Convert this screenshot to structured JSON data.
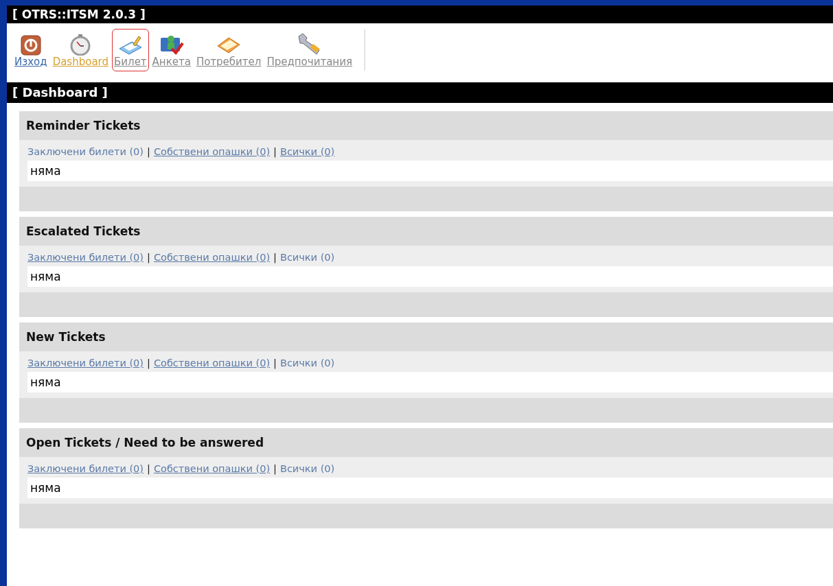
{
  "header": {
    "title": "[ OTRS::ITSM 2.0.3 ]"
  },
  "nav": [
    {
      "label": "Изход",
      "kind": "logout",
      "selected": false,
      "focused": false
    },
    {
      "label": "Dashboard",
      "kind": "dashboard",
      "selected": true,
      "focused": false
    },
    {
      "label": "Билет",
      "kind": "ticket",
      "selected": false,
      "focused": true
    },
    {
      "label": "Анкета",
      "kind": "survey",
      "selected": false,
      "focused": false
    },
    {
      "label": "Потребител",
      "kind": "customer",
      "selected": false,
      "focused": false
    },
    {
      "label": "Предпочитания",
      "kind": "preferences",
      "selected": false,
      "focused": false
    }
  ],
  "page_title": "[ Dashboard ]",
  "panels": [
    {
      "title": "Reminder Tickets",
      "filters": [
        {
          "label": "Заключени билети (0)",
          "selected": true
        },
        {
          "label": "Собствени опашки (0)",
          "selected": false
        },
        {
          "label": "Всички (0)",
          "selected": false
        }
      ],
      "separator": "|",
      "empty_text": "няма"
    },
    {
      "title": "Escalated Tickets",
      "filters": [
        {
          "label": "Заключени билети (0)",
          "selected": false
        },
        {
          "label": "Собствени опашки (0)",
          "selected": false
        },
        {
          "label": "Всички (0)",
          "selected": true
        }
      ],
      "separator": "|",
      "empty_text": "няма"
    },
    {
      "title": "New Tickets",
      "filters": [
        {
          "label": "Заключени билети (0)",
          "selected": false
        },
        {
          "label": "Собствени опашки (0)",
          "selected": false
        },
        {
          "label": "Всички (0)",
          "selected": true
        }
      ],
      "separator": "|",
      "empty_text": "няма"
    },
    {
      "title": "Open Tickets / Need to be answered",
      "filters": [
        {
          "label": "Заключени билети (0)",
          "selected": false
        },
        {
          "label": "Собствени опашки (0)",
          "selected": false
        },
        {
          "label": "Всички (0)",
          "selected": true
        }
      ],
      "separator": "|",
      "empty_text": "няма"
    }
  ]
}
